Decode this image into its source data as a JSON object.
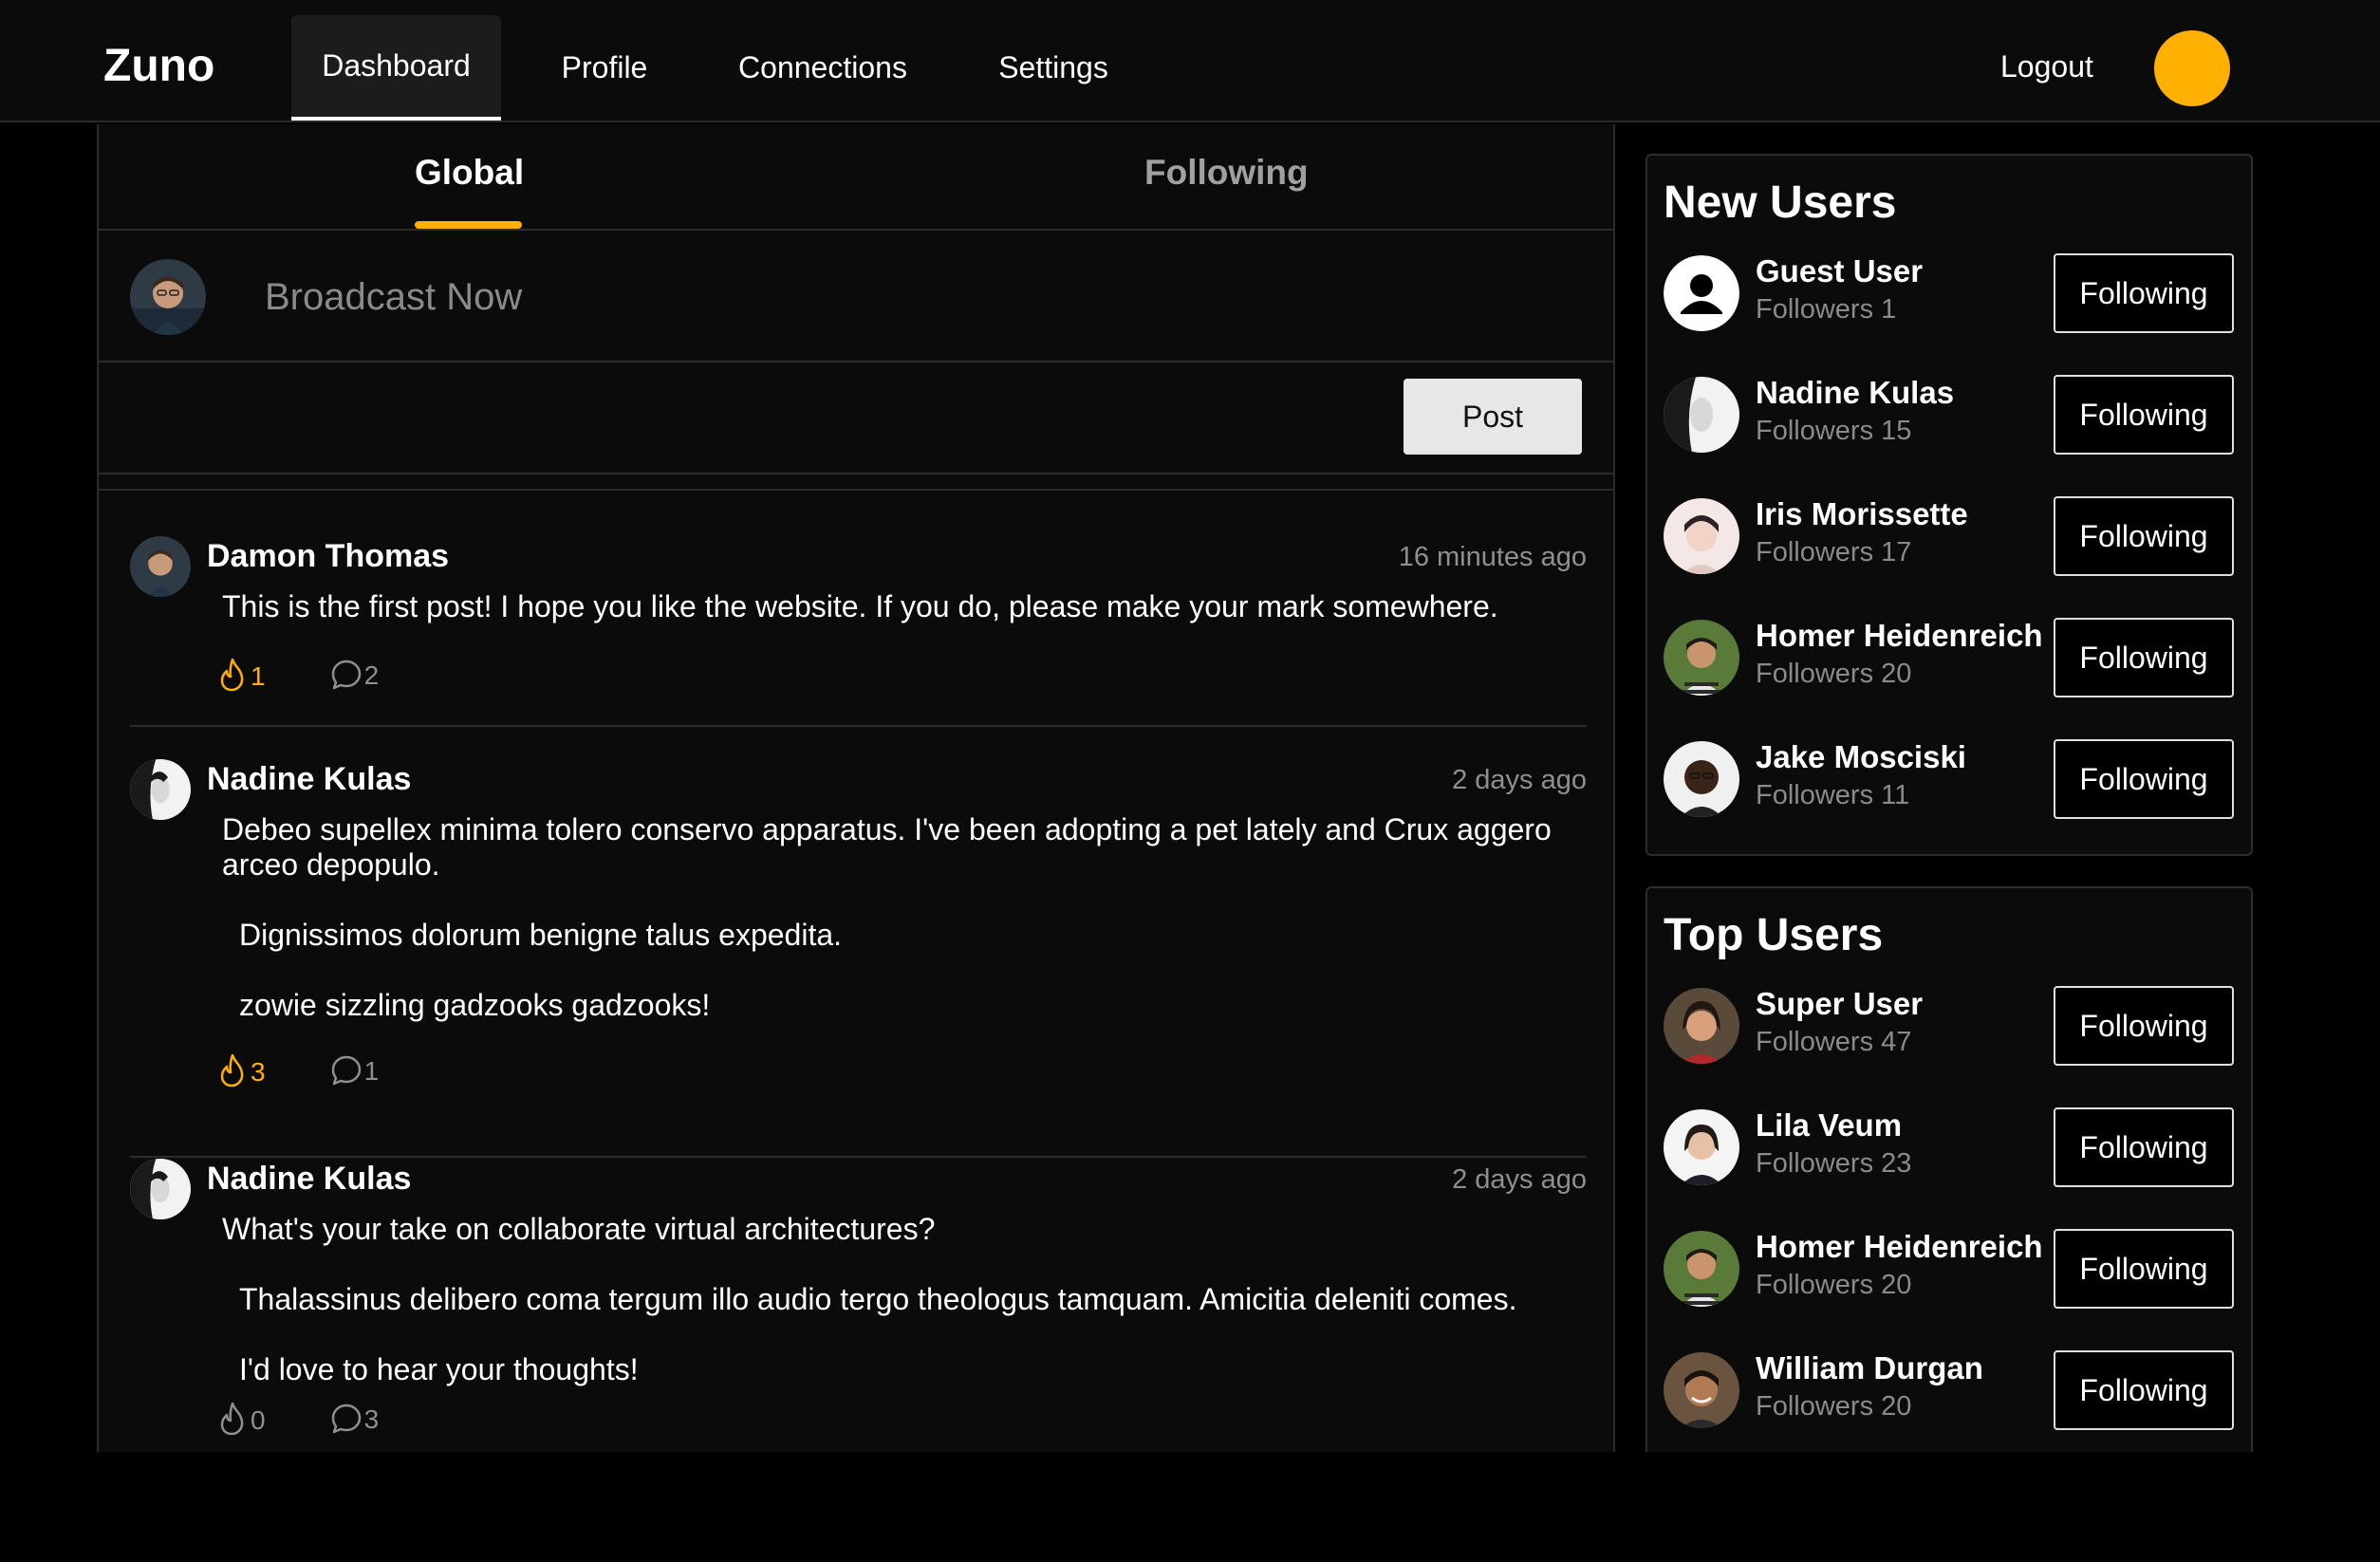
{
  "app": {
    "name": "Zuno",
    "accent": "#ffb000"
  },
  "nav": {
    "items": [
      {
        "label": "Dashboard",
        "active": true
      },
      {
        "label": "Profile",
        "active": false
      },
      {
        "label": "Connections",
        "active": false
      },
      {
        "label": "Settings",
        "active": false
      }
    ],
    "logout_label": "Logout"
  },
  "feed": {
    "tabs": [
      {
        "label": "Global",
        "active": true
      },
      {
        "label": "Following",
        "active": false
      }
    ],
    "composer": {
      "placeholder": "Broadcast Now",
      "post_label": "Post"
    },
    "posts": [
      {
        "author": "Damon Thomas",
        "time": "16 minutes ago",
        "paragraphs": [
          "This is the first post! I hope you like the website. If you do, please make your mark somewhere."
        ],
        "likes": "1",
        "comments": "2"
      },
      {
        "author": "Nadine Kulas",
        "time": "2 days ago",
        "paragraphs": [
          "Debeo supellex minima tolero conservo apparatus. I've been adopting a pet lately and Crux aggero arceo depopulo.",
          "Dignissimos dolorum benigne talus expedita.",
          "zowie sizzling gadzooks gadzooks!"
        ],
        "likes": "3",
        "comments": "1"
      },
      {
        "author": "Nadine Kulas",
        "time": "2 days ago",
        "paragraphs": [
          "What's your take on collaborate virtual architectures?",
          "Thalassinus delibero coma tergum illo audio tergo theologus tamquam. Amicitia deleniti comes.",
          "I'd love to hear your thoughts!"
        ],
        "likes": "0",
        "comments": "3"
      }
    ]
  },
  "new_users": {
    "title": "New Users",
    "users": [
      {
        "name": "Guest User",
        "followers": "Followers 1",
        "button": "Following",
        "avatar": "default-user-icon"
      },
      {
        "name": "Nadine Kulas",
        "followers": "Followers 15",
        "button": "Following",
        "avatar": "photo"
      },
      {
        "name": "Iris Morissette",
        "followers": "Followers 17",
        "button": "Following",
        "avatar": "photo"
      },
      {
        "name": "Homer Heidenreich",
        "followers": "Followers 20",
        "button": "Following",
        "avatar": "photo"
      },
      {
        "name": "Jake Mosciski",
        "followers": "Followers 11",
        "button": "Following",
        "avatar": "photo"
      }
    ]
  },
  "top_users": {
    "title": "Top Users",
    "users": [
      {
        "name": "Super User",
        "followers": "Followers 47",
        "button": "Following",
        "avatar": "photo"
      },
      {
        "name": "Lila Veum",
        "followers": "Followers 23",
        "button": "Following",
        "avatar": "photo"
      },
      {
        "name": "Homer Heidenreich",
        "followers": "Followers 20",
        "button": "Following",
        "avatar": "photo"
      },
      {
        "name": "William Durgan",
        "followers": "Followers 20",
        "button": "Following",
        "avatar": "photo"
      }
    ]
  }
}
